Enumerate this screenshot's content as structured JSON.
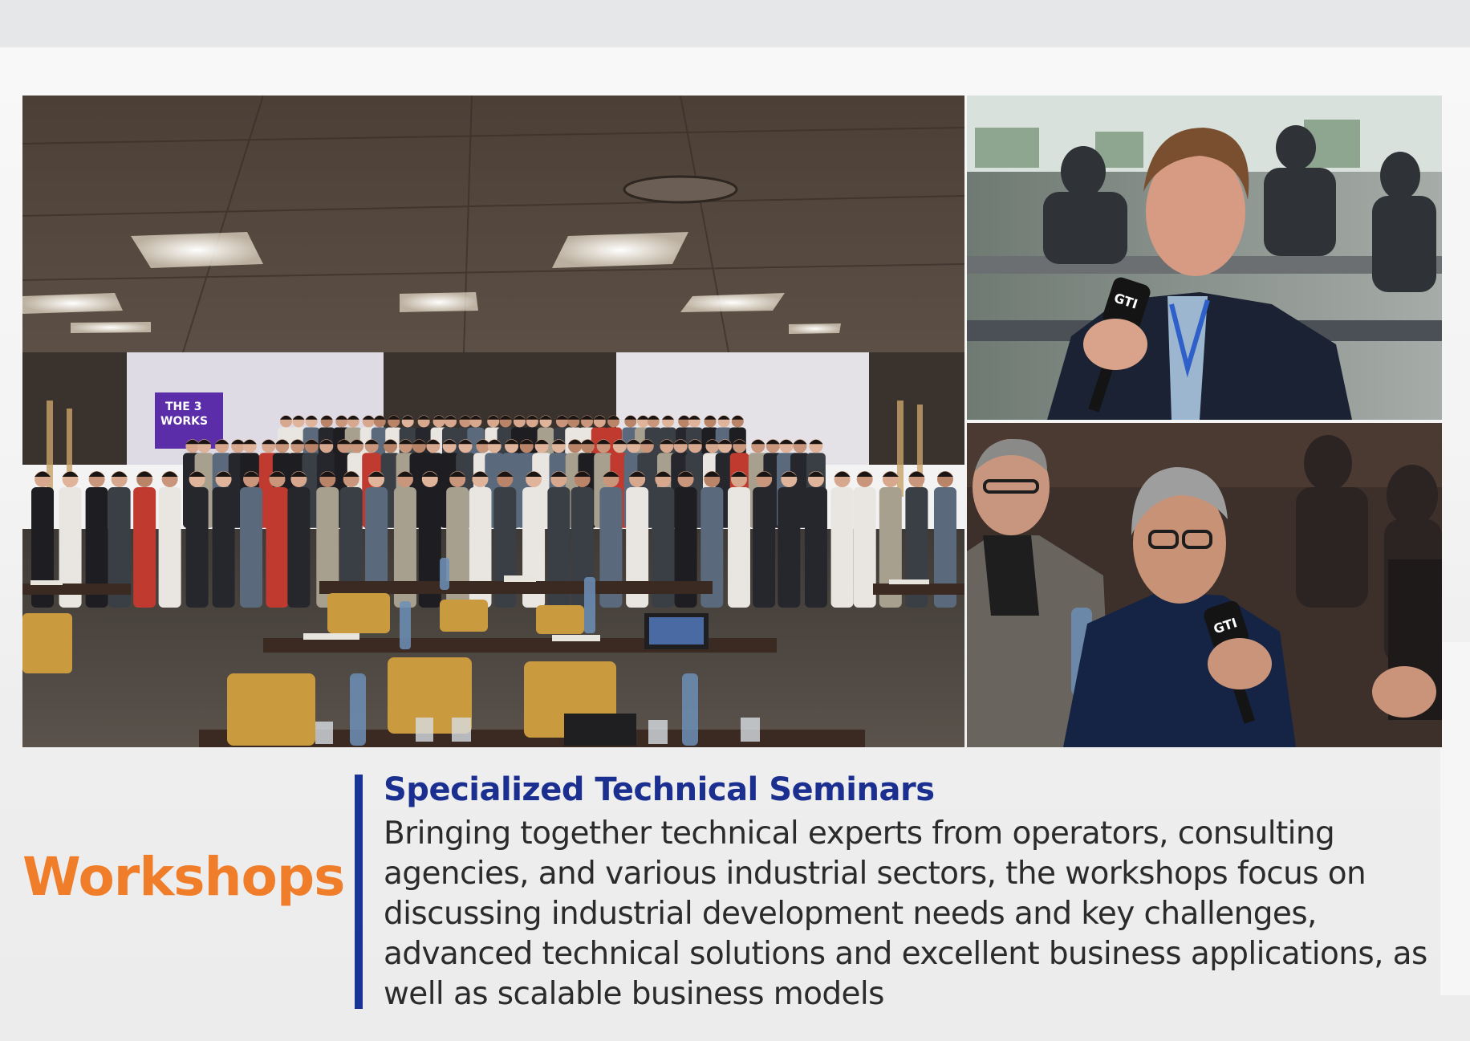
{
  "photos": {
    "main": {
      "screen_text": "THE 3\nWORKS"
    },
    "speaker_one": {
      "mic_label": "GTI"
    },
    "speaker_two": {
      "mic_label": "GTI"
    }
  },
  "section": {
    "label": "Workshops",
    "title": "Specialized Technical Seminars",
    "body": "Bringing together technical experts from operators, consulting agencies, and various industrial sectors, the workshops focus on discussing industrial development needs and key challenges, advanced technical solutions and excellent business applications, as well as scalable business models"
  },
  "colors": {
    "accent_orange": "#f07d2a",
    "accent_blue": "#1a2f8f"
  }
}
